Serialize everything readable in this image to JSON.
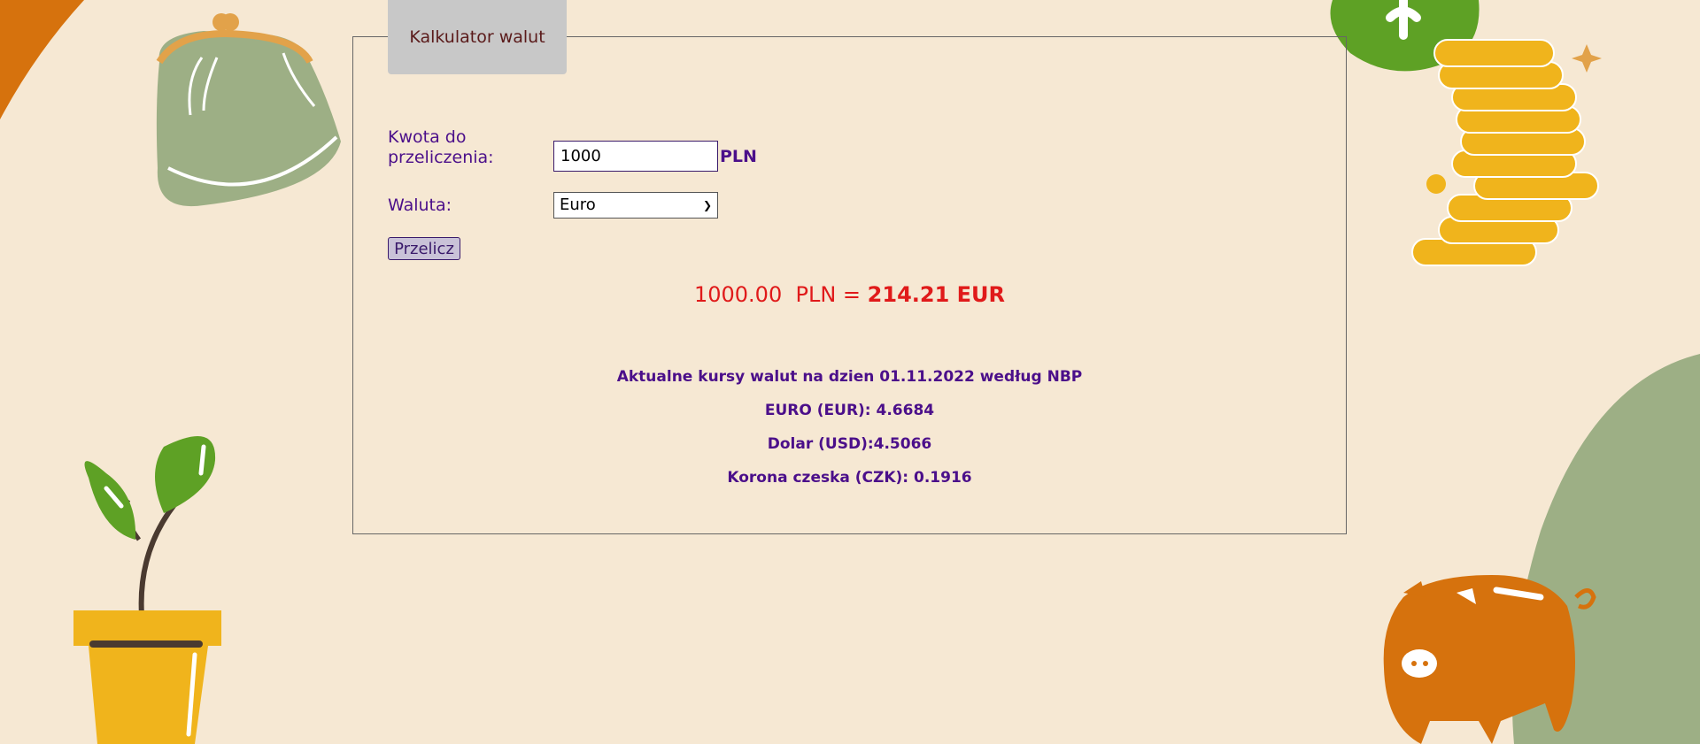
{
  "app": {
    "tab_title": "Kalkulator walut"
  },
  "form": {
    "amount_label": "Kwota do przeliczenia:",
    "amount_value": "1000",
    "amount_unit": "PLN",
    "currency_label": "Waluta:",
    "currency_selected": "Euro",
    "button_label": "Przelicz"
  },
  "result": {
    "input_amount": "1000.00",
    "input_currency": "PLN",
    "equals": "=",
    "output": "214.21 EUR"
  },
  "rates": {
    "heading": "Aktualne kursy walut na dzien 01.11.2022 według NBP",
    "items": [
      "EURO (EUR): 4.6684",
      "Dolar (USD):4.5066",
      "Korona czeska (CZK): 0.1916"
    ]
  },
  "colors": {
    "background": "#f6e8d3",
    "accent_purple": "#4b0f8a",
    "result_red": "#e01a1a",
    "orange": "#d6720d",
    "sage": "#9daf85",
    "green": "#5ea125",
    "gold": "#f0b41c"
  }
}
